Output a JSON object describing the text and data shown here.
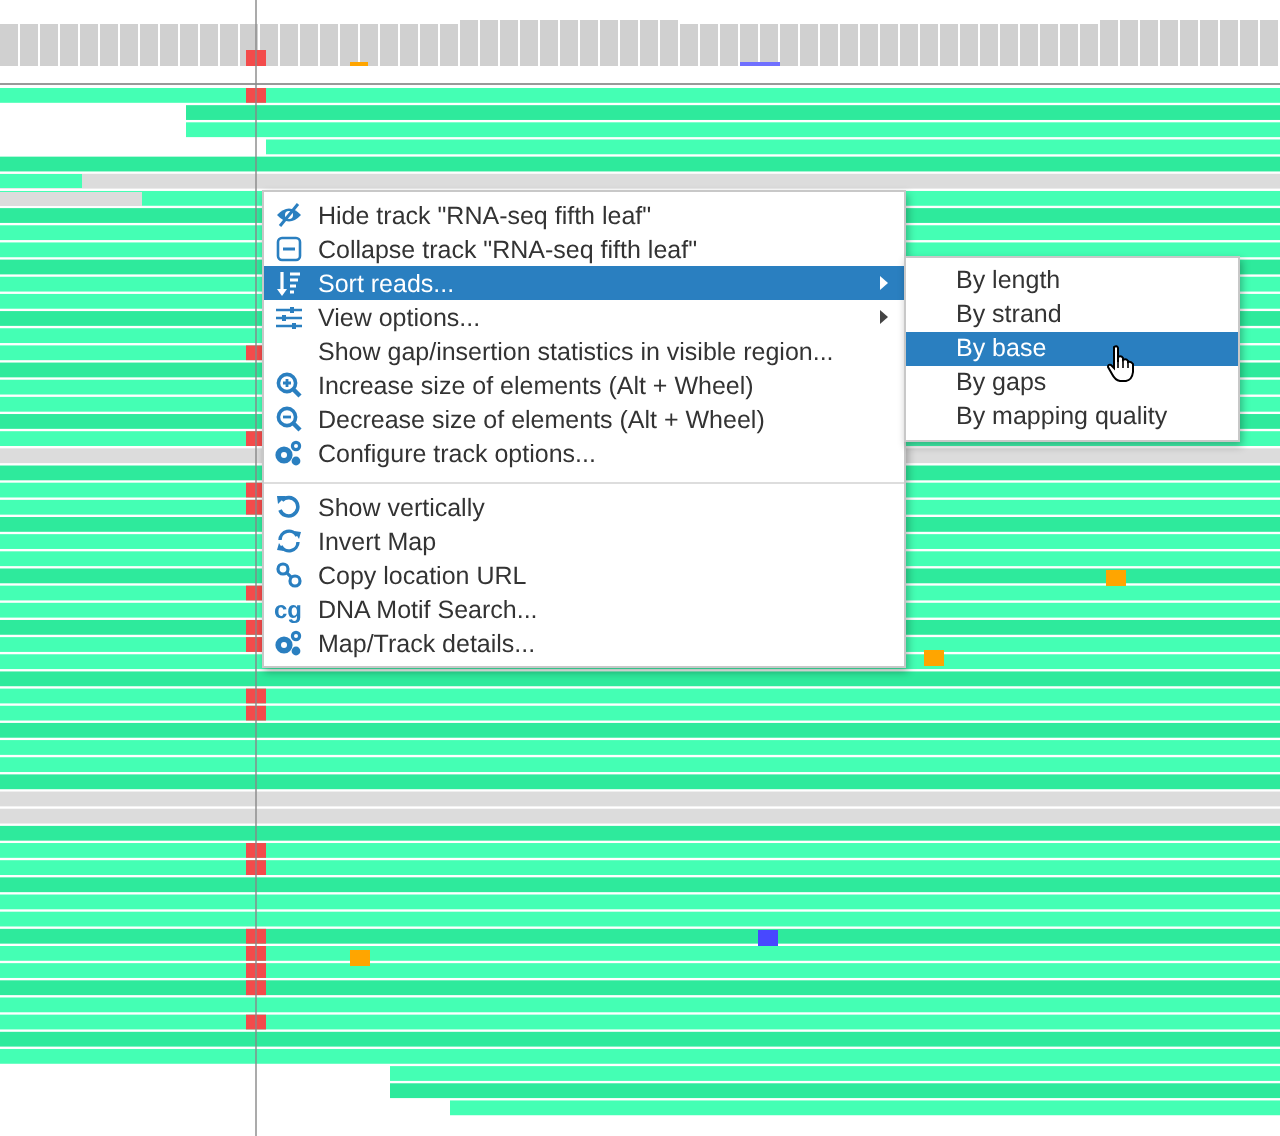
{
  "context_menu": {
    "items": [
      {
        "kind": "item",
        "label": "Hide track \"RNA-seq fifth leaf\"",
        "submenu": false,
        "selected": false
      },
      {
        "kind": "item",
        "label": "Collapse track \"RNA-seq fifth leaf\"",
        "submenu": false,
        "selected": false
      },
      {
        "kind": "item",
        "label": "Sort reads...",
        "submenu": true,
        "selected": true
      },
      {
        "kind": "item",
        "label": "View options...",
        "submenu": true,
        "selected": false
      },
      {
        "kind": "item",
        "label": "Show gap/insertion statistics in visible region...",
        "submenu": false,
        "selected": false
      },
      {
        "kind": "item",
        "label": "Increase size of elements (Alt + Wheel)",
        "submenu": false,
        "selected": false
      },
      {
        "kind": "item",
        "label": "Decrease size of elements (Alt + Wheel)",
        "submenu": false,
        "selected": false
      },
      {
        "kind": "item",
        "label": "Configure track options...",
        "submenu": false,
        "selected": false
      },
      {
        "kind": "separator"
      },
      {
        "kind": "item",
        "label": "Show vertically",
        "submenu": false,
        "selected": false
      },
      {
        "kind": "item",
        "label": "Invert Map",
        "submenu": false,
        "selected": false
      },
      {
        "kind": "item",
        "label": "Copy location URL",
        "submenu": false,
        "selected": false
      },
      {
        "kind": "item",
        "icon_text": "cg",
        "label": "DNA Motif Search...",
        "submenu": false,
        "selected": false
      },
      {
        "kind": "item",
        "label": "Map/Track details...",
        "submenu": false,
        "selected": false
      }
    ]
  },
  "submenu": {
    "items": [
      {
        "label": "By length",
        "selected": false
      },
      {
        "label": "By strand",
        "selected": false
      },
      {
        "label": "By base",
        "selected": true
      },
      {
        "label": "By gaps",
        "selected": false
      },
      {
        "label": "By mapping quality",
        "selected": false
      }
    ]
  }
}
